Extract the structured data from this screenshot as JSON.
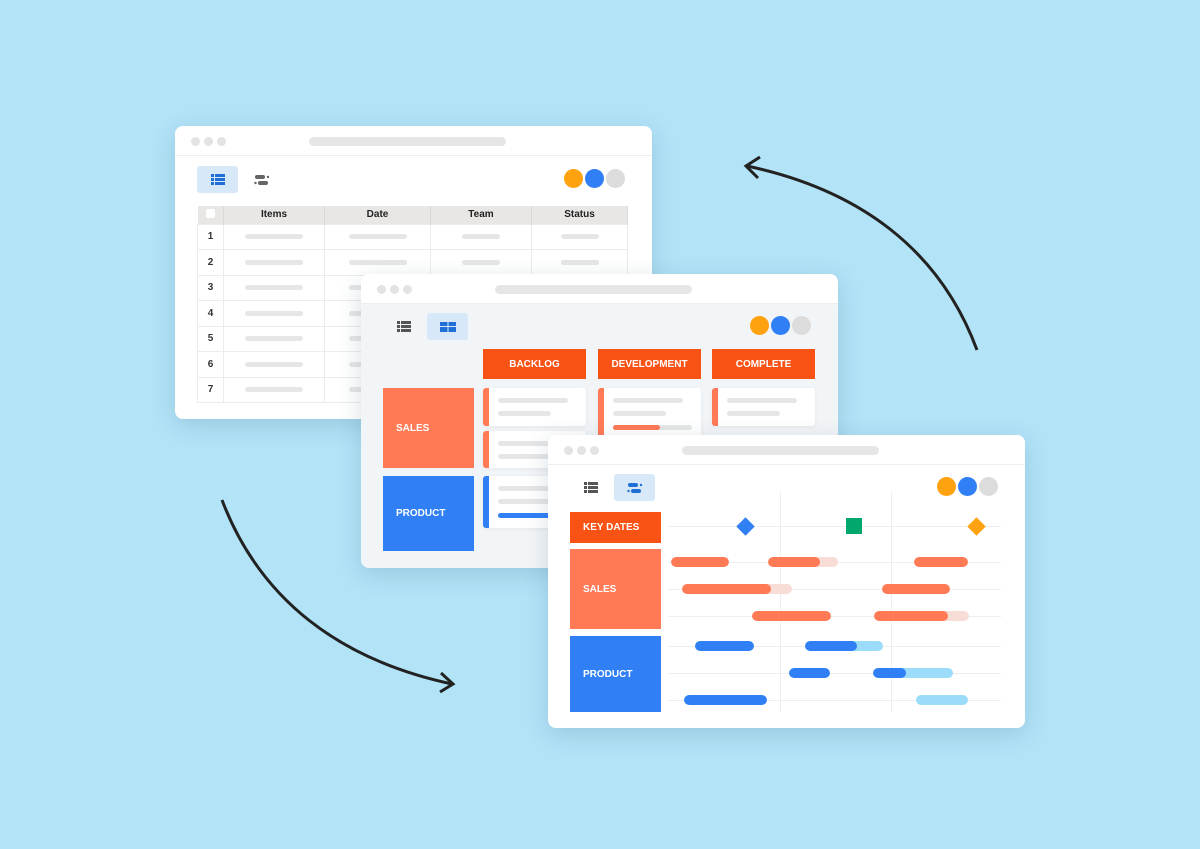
{
  "colors": {
    "background": "#b2e3f7",
    "orange": "#f85215",
    "sales": "#ff7a55",
    "product": "#307ff5",
    "avatar_orange": "#ffa20f",
    "avatar_blue": "#307ff5",
    "avatar_gray": "#dcdcdc",
    "milestone_green": "#00a86b"
  },
  "table_window": {
    "view_buttons": [
      {
        "icon": "list-icon",
        "active": true
      },
      {
        "icon": "timeline-icon",
        "active": false
      }
    ],
    "columns": [
      "Items",
      "Date",
      "Team",
      "Status"
    ],
    "rows": [
      "1",
      "2",
      "3",
      "4",
      "5",
      "6",
      "7"
    ]
  },
  "board_window": {
    "view_buttons": [
      {
        "icon": "list-icon",
        "active": false
      },
      {
        "icon": "board-icon",
        "active": true
      }
    ],
    "columns": [
      "BACKLOG",
      "DEVELOPMENT",
      "COMPLETE"
    ],
    "groups": [
      "SALES",
      "PRODUCT"
    ],
    "development_card_progress": 0.6,
    "product_card_progress": 1.0
  },
  "timeline_window": {
    "view_buttons": [
      {
        "icon": "list-icon",
        "active": false
      },
      {
        "icon": "timeline-icon",
        "active": true
      }
    ],
    "groups": [
      "KEY DATES",
      "SALES",
      "PRODUCT"
    ],
    "milestones": [
      {
        "shape": "diamond",
        "color": "#307ff5"
      },
      {
        "shape": "square",
        "color": "#00a86b"
      },
      {
        "shape": "diamond",
        "color": "#ffa20f"
      }
    ]
  },
  "arrows": [
    "cycle-arrow-top",
    "cycle-arrow-bottom"
  ]
}
